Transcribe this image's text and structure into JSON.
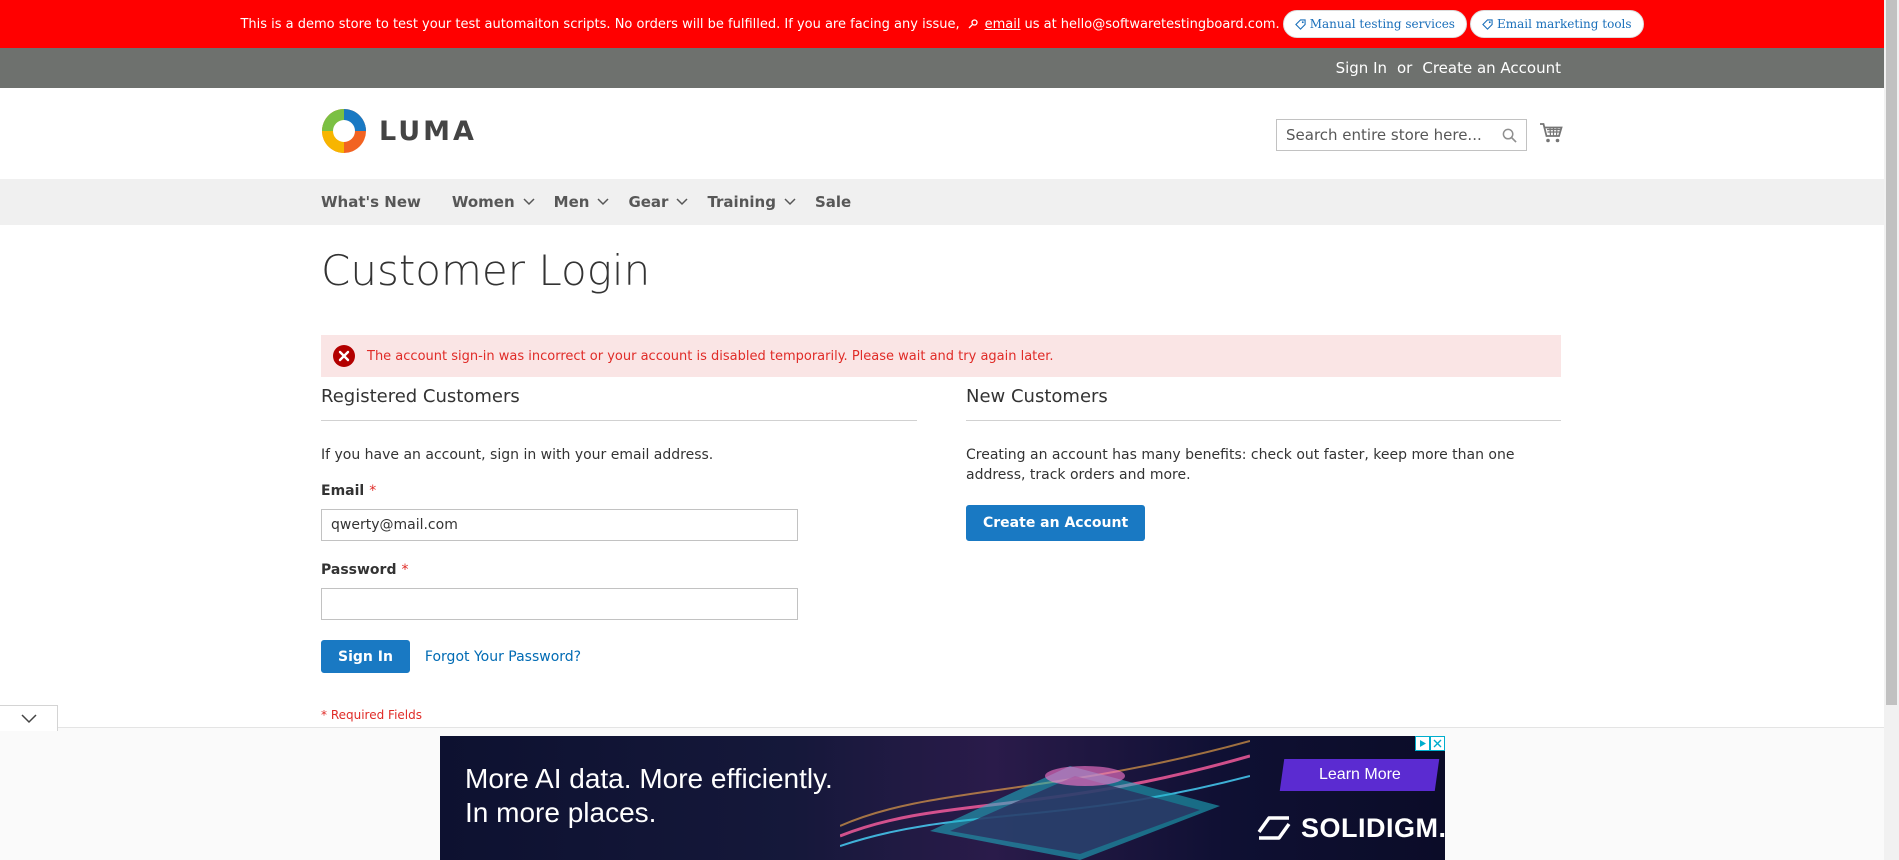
{
  "demo_banner": {
    "text": "This is a demo store to test your test automaiton scripts. No orders will be fulfilled. If you are facing any issue,",
    "email_link": "email",
    "email_suffix": "us at hello@softwaretestingboard.com.",
    "pills": [
      "Manual testing services",
      "Email marketing tools"
    ]
  },
  "header": {
    "sign_in": "Sign In",
    "or": "or",
    "create_account": "Create an Account"
  },
  "logo": {
    "text": "LUMA"
  },
  "search": {
    "placeholder": "Search entire store here..."
  },
  "nav": {
    "items": [
      {
        "label": "What's New",
        "has_submenu": false
      },
      {
        "label": "Women",
        "has_submenu": true
      },
      {
        "label": "Men",
        "has_submenu": true
      },
      {
        "label": "Gear",
        "has_submenu": true
      },
      {
        "label": "Training",
        "has_submenu": true
      },
      {
        "label": "Sale",
        "has_submenu": false
      }
    ]
  },
  "page": {
    "title": "Customer Login",
    "error": "The account sign-in was incorrect or your account is disabled temporarily. Please wait and try again later."
  },
  "registered": {
    "title": "Registered Customers",
    "intro": "If you have an account, sign in with your email address.",
    "email_label": "Email",
    "email_value": "qwerty@mail.com",
    "password_label": "Password",
    "required_mark": "*",
    "sign_in_button": "Sign In",
    "forgot_link": "Forgot Your Password?",
    "required_note": "* Required Fields"
  },
  "new_customers": {
    "title": "New Customers",
    "text": "Creating an account has many benefits: check out faster, keep more than one address, track orders and more.",
    "button": "Create an Account"
  },
  "ad": {
    "headline_line1": "More AI data. More efficiently.",
    "headline_line2": "In more places.",
    "cta": "Learn More",
    "brand": "SOLIDIGM."
  },
  "colors": {
    "banner": "#ff0000",
    "header": "#6e716e",
    "primary_button": "#1979c3",
    "link": "#006bb4",
    "error_text": "#e02b27",
    "error_bg": "#fae5e5"
  }
}
